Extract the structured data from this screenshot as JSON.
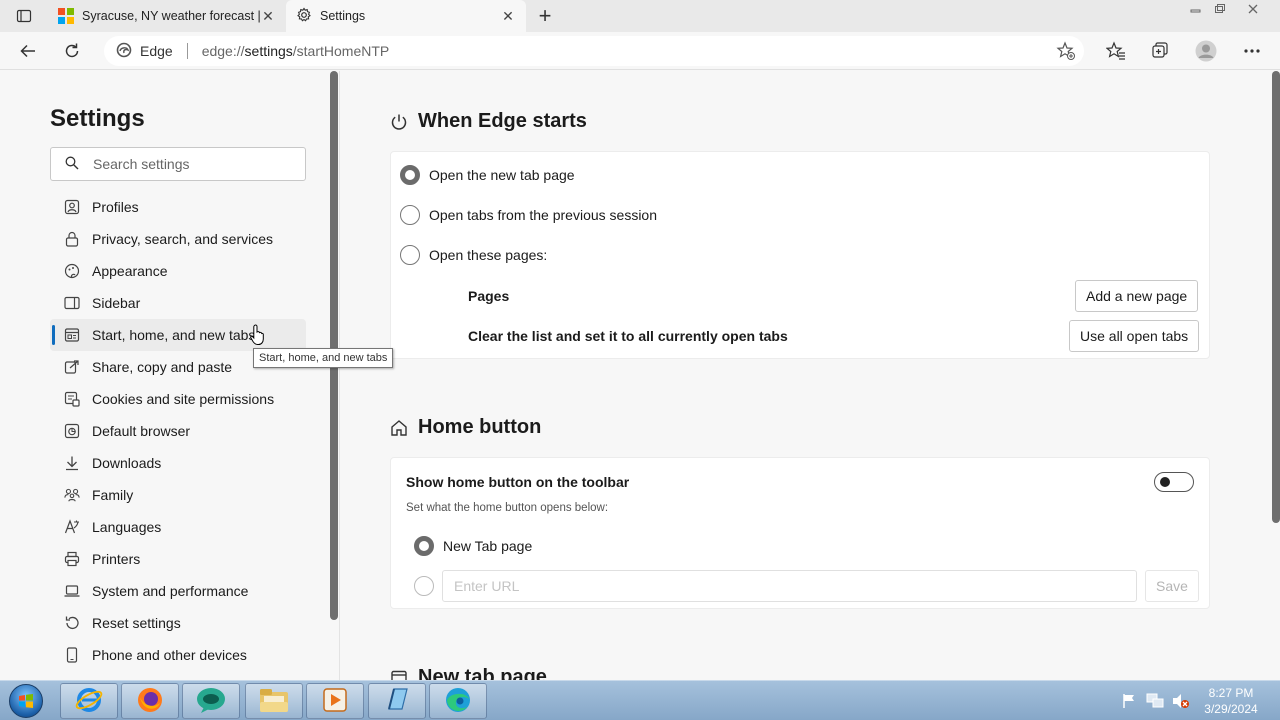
{
  "tabs": [
    {
      "title": "Syracuse, NY weather forecast | Microsoft",
      "icon": "microsoft-logo-icon",
      "active": false
    },
    {
      "title": "Settings",
      "icon": "gear-icon",
      "active": true
    }
  ],
  "address": {
    "site_name": "Edge",
    "url_scheme": "edge://",
    "url_host": "settings",
    "url_path": "/startHomeNTP"
  },
  "sidebar": {
    "title": "Settings",
    "search_placeholder": "Search settings",
    "items": [
      {
        "label": "Profiles",
        "icon": "profile-icon"
      },
      {
        "label": "Privacy, search, and services",
        "icon": "lock-icon"
      },
      {
        "label": "Appearance",
        "icon": "appearance-icon"
      },
      {
        "label": "Sidebar",
        "icon": "sidebar-icon"
      },
      {
        "label": "Start, home, and new tabs",
        "icon": "start-home-icon",
        "selected": true
      },
      {
        "label": "Share, copy and paste",
        "icon": "share-icon"
      },
      {
        "label": "Cookies and site permissions",
        "icon": "cookies-icon"
      },
      {
        "label": "Default browser",
        "icon": "browser-icon"
      },
      {
        "label": "Downloads",
        "icon": "download-icon"
      },
      {
        "label": "Family",
        "icon": "family-icon"
      },
      {
        "label": "Languages",
        "icon": "language-icon"
      },
      {
        "label": "Printers",
        "icon": "printer-icon"
      },
      {
        "label": "System and performance",
        "icon": "laptop-icon"
      },
      {
        "label": "Reset settings",
        "icon": "reset-icon"
      },
      {
        "label": "Phone and other devices",
        "icon": "phone-icon"
      }
    ]
  },
  "tooltip": "Start, home, and new tabs",
  "when_edge_starts": {
    "heading": "When Edge starts",
    "options": [
      {
        "label": "Open the new tab page",
        "checked": true
      },
      {
        "label": "Open tabs from the previous session",
        "checked": false
      },
      {
        "label": "Open these pages:",
        "checked": false
      }
    ],
    "pages_label": "Pages",
    "add_page_button": "Add a new page",
    "clear_list_label": "Clear the list and set it to all currently open tabs",
    "use_all_tabs_button": "Use all open tabs"
  },
  "home_button": {
    "heading": "Home button",
    "toggle_label": "Show home button on the toolbar",
    "toggle_on": false,
    "description": "Set what the home button opens below:",
    "option_new_tab": "New Tab page",
    "url_placeholder": "Enter URL",
    "save_button": "Save"
  },
  "new_tab_page": {
    "heading": "New tab page"
  },
  "taskbar": {
    "apps": [
      "internet-explorer-icon",
      "firefox-icon",
      "chat-app-icon",
      "file-explorer-icon",
      "media-player-icon",
      "notepad-icon",
      "edge-icon"
    ],
    "time": "8:27 PM",
    "date": "3/29/2024"
  },
  "colors": {
    "accent": "#0f6cbd",
    "taskbar": "#9ab8d6"
  }
}
